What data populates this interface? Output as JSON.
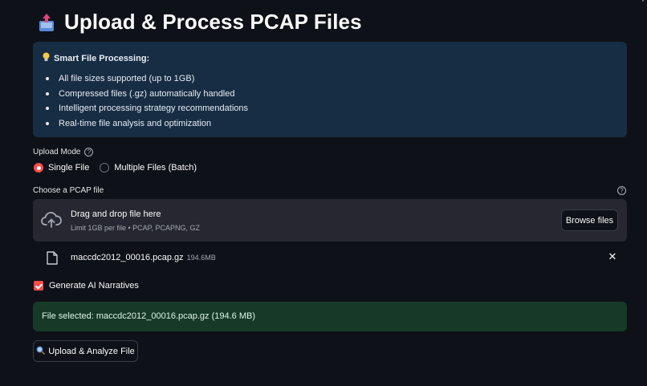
{
  "header": {
    "title": "Upload & Process PCAP Files",
    "icon": "inbox-upload-icon"
  },
  "info": {
    "heading": "Smart File Processing:",
    "icon": "lightbulb-icon",
    "items": [
      "All file sizes supported (up to 1GB)",
      "Compressed files (.gz) automatically handled",
      "Intelligent processing strategy recommendations",
      "Real-time file analysis and optimization"
    ]
  },
  "upload_mode": {
    "label": "Upload Mode",
    "options": [
      "Single File",
      "Multiple Files (Batch)"
    ],
    "selected": "Single File"
  },
  "uploader": {
    "label": "Choose a PCAP file",
    "drop_title": "Drag and drop file here",
    "drop_subtitle": "Limit 1GB per file • PCAP, PCAPNG, GZ",
    "browse_label": "Browse files"
  },
  "file": {
    "name": "maccdc2012_00016.pcap.gz",
    "size": "194.6MB"
  },
  "narratives": {
    "label": "Generate AI Narratives",
    "checked": true
  },
  "status": {
    "text": "File selected: maccdc2012_00016.pcap.gz (194.6 MB)"
  },
  "actions": {
    "analyze_label": "Upload & Analyze File"
  },
  "colors": {
    "background": "#0e1117",
    "info_bg": "#172d43",
    "success_bg": "#173928",
    "accent": "#ff4b4b",
    "dropzone_bg": "#262730"
  }
}
